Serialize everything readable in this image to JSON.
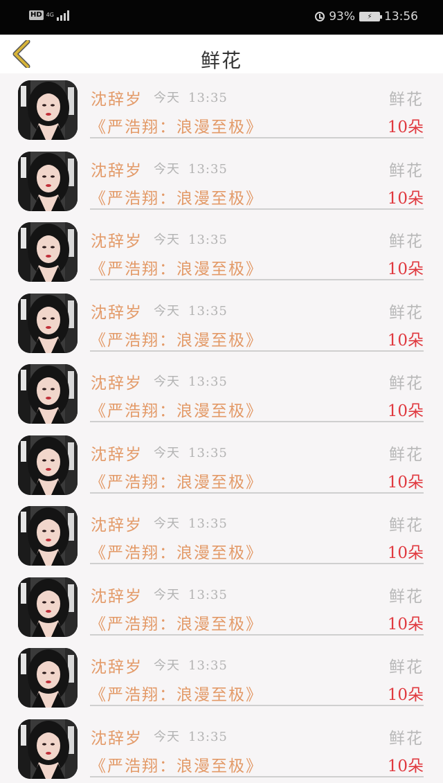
{
  "status_bar": {
    "hd": "HD",
    "network": "4G",
    "battery_percent": "93%",
    "time": "13:56"
  },
  "header": {
    "title": "鲜花",
    "back_icon": "chevron-left-icon"
  },
  "colors": {
    "accent": "#e39a68",
    "count": "#e0393f",
    "muted": "#b3b3b3",
    "back_icon": "#d7b43a"
  },
  "records": [
    {
      "name": "沈辞岁",
      "day": "今天",
      "time": "13:35",
      "type": "鲜花",
      "book": "《严浩翔：浪漫至极》",
      "count": "10朵"
    },
    {
      "name": "沈辞岁",
      "day": "今天",
      "time": "13:35",
      "type": "鲜花",
      "book": "《严浩翔：浪漫至极》",
      "count": "10朵"
    },
    {
      "name": "沈辞岁",
      "day": "今天",
      "time": "13:35",
      "type": "鲜花",
      "book": "《严浩翔：浪漫至极》",
      "count": "10朵"
    },
    {
      "name": "沈辞岁",
      "day": "今天",
      "time": "13:35",
      "type": "鲜花",
      "book": "《严浩翔：浪漫至极》",
      "count": "10朵"
    },
    {
      "name": "沈辞岁",
      "day": "今天",
      "time": "13:35",
      "type": "鲜花",
      "book": "《严浩翔：浪漫至极》",
      "count": "10朵"
    },
    {
      "name": "沈辞岁",
      "day": "今天",
      "time": "13:35",
      "type": "鲜花",
      "book": "《严浩翔：浪漫至极》",
      "count": "10朵"
    },
    {
      "name": "沈辞岁",
      "day": "今天",
      "time": "13:35",
      "type": "鲜花",
      "book": "《严浩翔：浪漫至极》",
      "count": "10朵"
    },
    {
      "name": "沈辞岁",
      "day": "今天",
      "time": "13:35",
      "type": "鲜花",
      "book": "《严浩翔：浪漫至极》",
      "count": "10朵"
    },
    {
      "name": "沈辞岁",
      "day": "今天",
      "time": "13:35",
      "type": "鲜花",
      "book": "《严浩翔：浪漫至极》",
      "count": "10朵"
    },
    {
      "name": "沈辞岁",
      "day": "今天",
      "time": "13:35",
      "type": "鲜花",
      "book": "《严浩翔：浪漫至极》",
      "count": "10朵"
    }
  ]
}
